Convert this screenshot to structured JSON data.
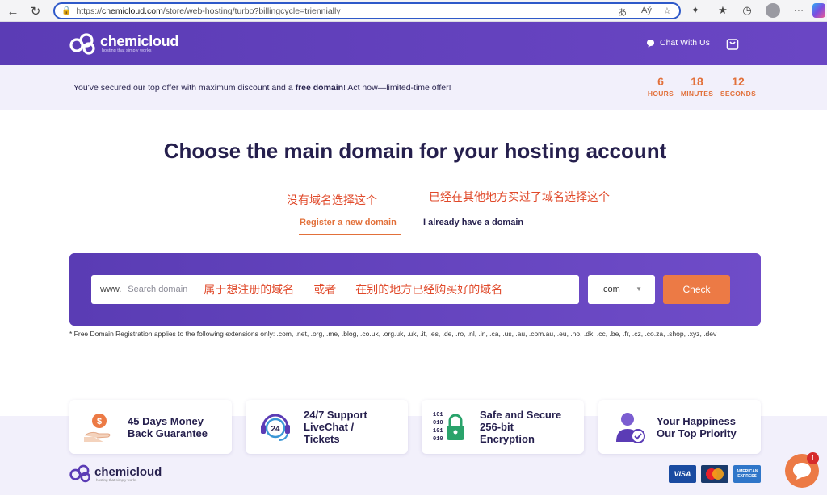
{
  "browser": {
    "url_scheme": "https://",
    "url_domain": "chemicloud.com",
    "url_path": "/store/web-hosting/turbo?billingcycle=triennially"
  },
  "header": {
    "logo_name": "chemicloud",
    "logo_tagline": "hosting that simply works",
    "chat_label": "Chat With Us"
  },
  "offer": {
    "text_before": "You've secured our top offer with maximum discount and a ",
    "text_bold": "free domain",
    "text_after": "! Act now—limited-time offer!",
    "timers": [
      {
        "value": "6",
        "label": "HOURS"
      },
      {
        "value": "18",
        "label": "MINUTES"
      },
      {
        "value": "12",
        "label": "SECONDS"
      }
    ]
  },
  "main": {
    "title": "Choose the main domain for your hosting account",
    "annotation_left": "没有域名选择这个",
    "annotation_right": "已经在其他地方买过了域名选择这个",
    "tab_register": "Register a new domain",
    "tab_existing": "I already have a domain"
  },
  "search": {
    "prefix": "www.",
    "placeholder": "Search domain",
    "annotation_1": "属于想注册的域名",
    "annotation_2": "或者",
    "annotation_3": "在别的地方已经购买好的域名",
    "tld_value": ".com",
    "check_label": "Check"
  },
  "note": "* Free Domain Registration applies to the following extensions only: .com, .net, .org, .me, .blog, .co.uk, .org.uk, .uk, .it, .es, .de, .ro, .nl, .in, .ca, .us, .au, .com.au, .eu, .no, .dk, .cc, .be, .fr, .cz, .co.za, .shop, .xyz, .dev",
  "features": [
    {
      "line1": "45 Days Money",
      "line2": "Back Guarantee",
      "line3": "",
      "icon": "money-back-icon"
    },
    {
      "line1": "24/7 Support",
      "line2": "LiveChat /",
      "line3": "Tickets",
      "icon": "support-24-icon"
    },
    {
      "line1": "Safe and Secure",
      "line2": "256-bit",
      "line3": "Encryption",
      "icon": "lock-icon"
    },
    {
      "line1": "Your Happiness",
      "line2": "Our Top Priority",
      "line3": "",
      "icon": "happy-customer-icon"
    }
  ],
  "footer": {
    "logo_name": "chemicloud",
    "logo_tagline": "hosting that simply works",
    "cards": [
      "VISA",
      "",
      "AMERICAN EXPRESS"
    ]
  },
  "chat_widget": {
    "badge_count": "1"
  },
  "colors": {
    "brand_purple": "#5b3cb5",
    "accent_orange": "#ec7a45",
    "annotation_red": "#e0492a"
  }
}
